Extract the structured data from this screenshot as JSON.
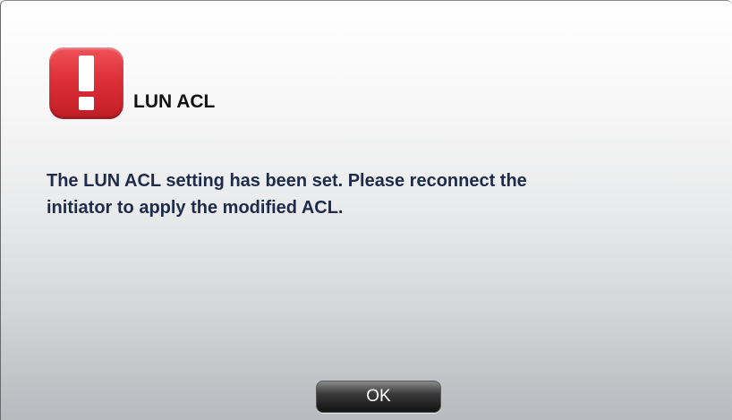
{
  "dialog": {
    "icon": "alert-exclamation-icon",
    "title": "LUN ACL",
    "message_line1": "The LUN ACL setting has been set. Please reconnect the",
    "message_line2": "initiator to apply the modified ACL.",
    "ok_label": "OK"
  },
  "colors": {
    "icon_red": "#de2f38",
    "message_text": "#1e2b4a",
    "button_dark": "#111111"
  }
}
